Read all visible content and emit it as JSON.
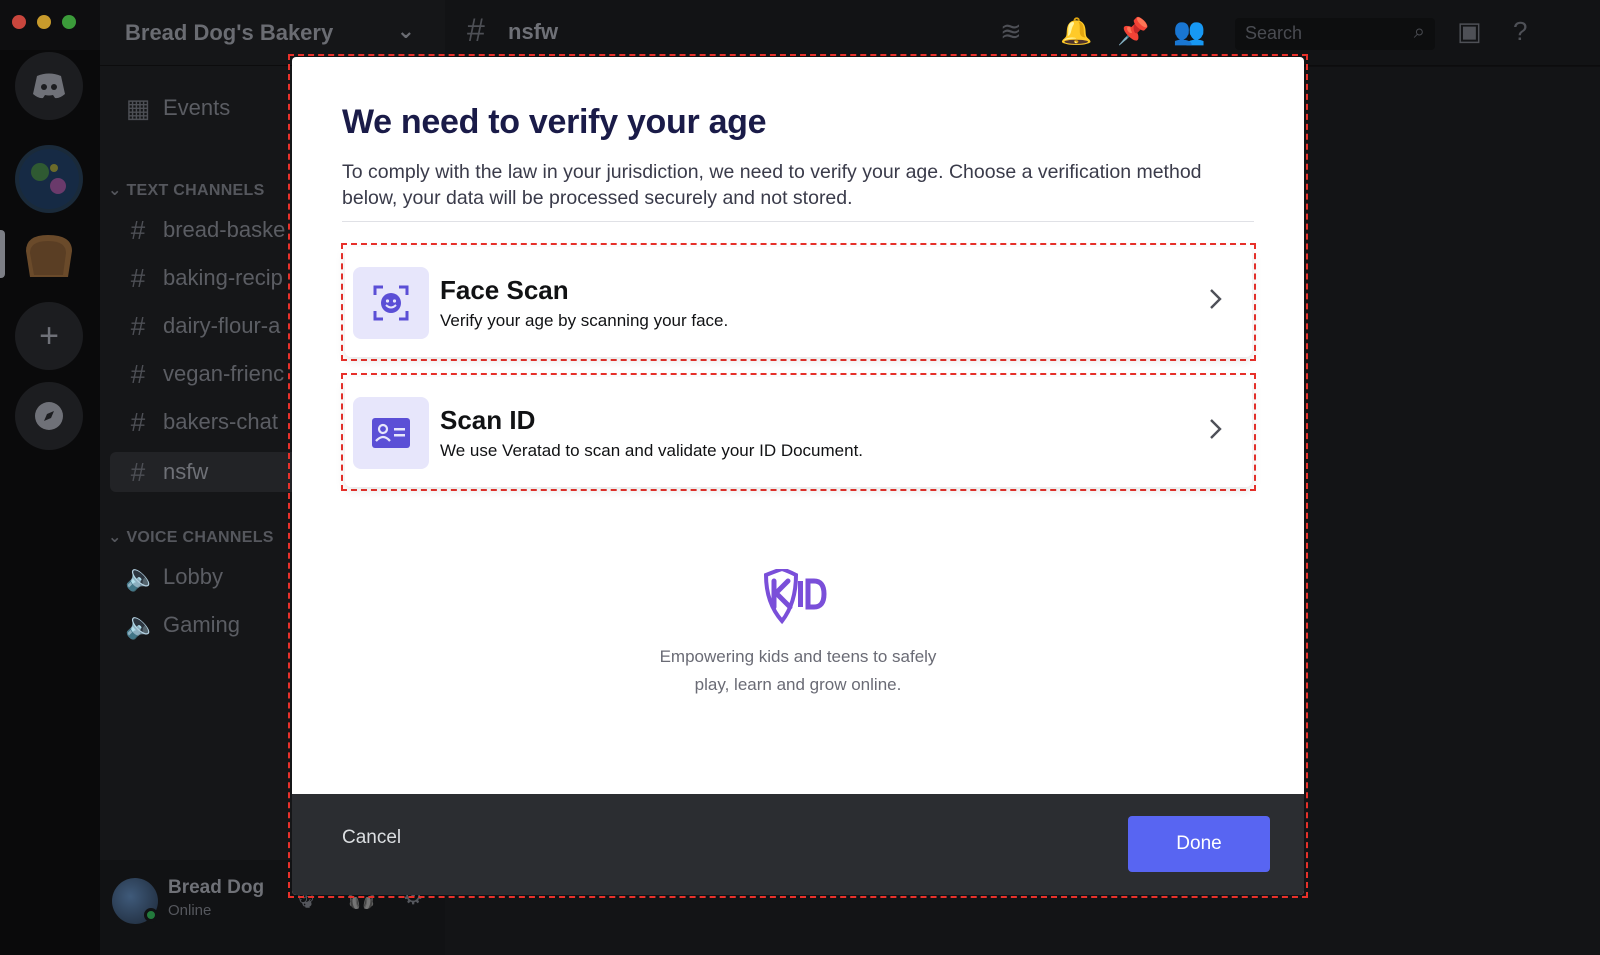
{
  "app": {
    "server_name": "Bread Dog's Bakery",
    "channel_title": "nsfw",
    "search_placeholder": "Search"
  },
  "sidebar": {
    "events_label": "Events",
    "text_category": "TEXT CHANNELS",
    "text_channels": [
      {
        "label": "bread-baske"
      },
      {
        "label": "baking-recip"
      },
      {
        "label": "dairy-flour-a"
      },
      {
        "label": "vegan-frienc"
      },
      {
        "label": "bakers-chat"
      },
      {
        "label": "nsfw"
      }
    ],
    "voice_category": "VOICE CHANNELS",
    "voice_channels": [
      {
        "label": "Lobby"
      },
      {
        "label": "Gaming"
      }
    ]
  },
  "user": {
    "name": "Bread Dog",
    "status": "Online"
  },
  "modal": {
    "title": "We need to verify your age",
    "description": "To comply with the law in your jurisdiction, we need to verify your age. Choose a verification method below, your data will be processed securely and not stored.",
    "options": [
      {
        "title": "Face Scan",
        "subtitle": "Verify your age by scanning your face.",
        "icon": "face-scan-icon"
      },
      {
        "title": "Scan ID",
        "subtitle": "We use Veratad to scan and validate your ID Document.",
        "icon": "id-card-icon"
      }
    ],
    "brand_tagline_line1": "Empowering kids and teens to safely",
    "brand_tagline_line2": "play, learn and grow online.",
    "cancel_label": "Cancel",
    "done_label": "Done"
  },
  "colors": {
    "accent": "#5865f2",
    "title": "#1a1b48",
    "icon_bg": "#e7e6fb",
    "icon_fg": "#5b4fd6",
    "annotation": "#e8312b"
  }
}
